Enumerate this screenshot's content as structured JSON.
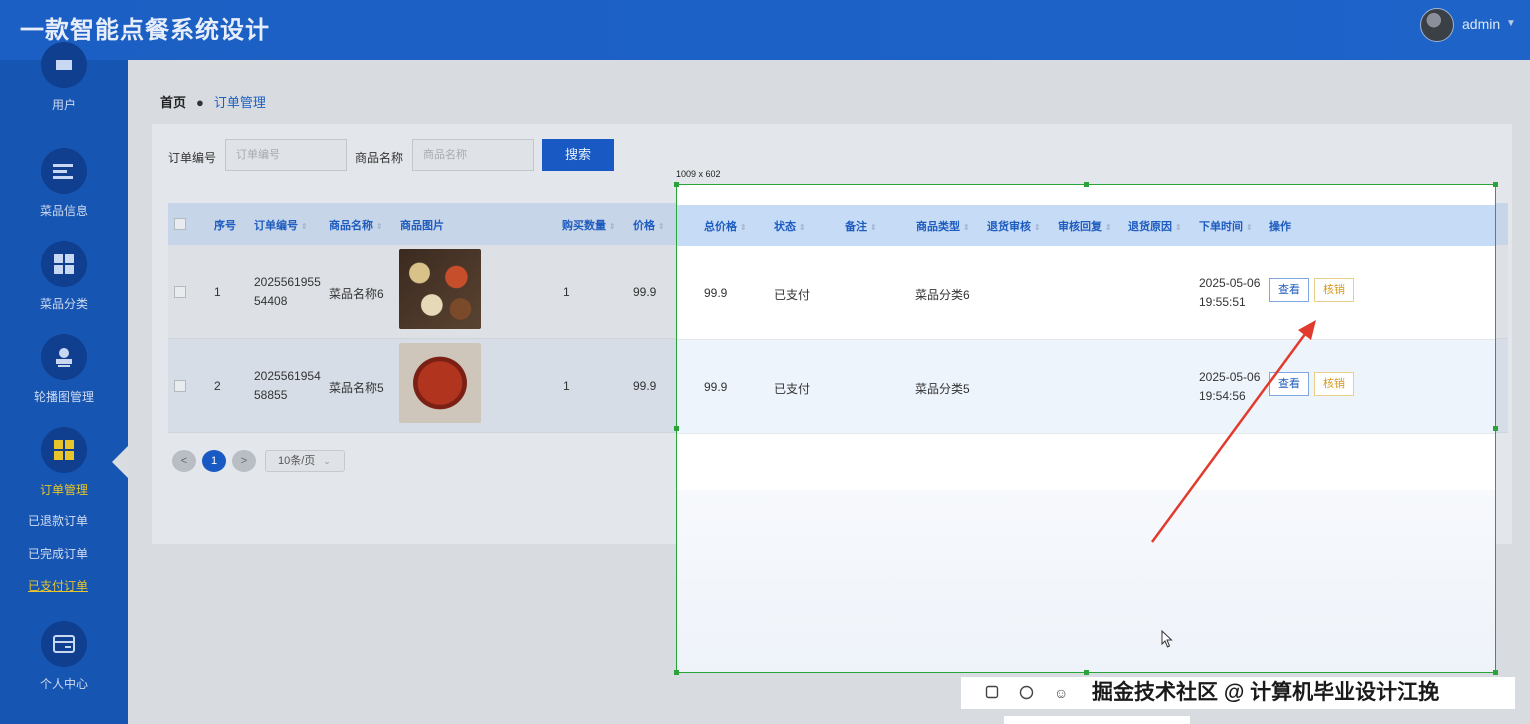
{
  "header": {
    "title": "一款智能点餐系统设计",
    "user": "admin"
  },
  "sidebar": {
    "items": [
      {
        "label": "用户",
        "icon": "user-icon"
      },
      {
        "label": "菜品信息",
        "icon": "list-icon"
      },
      {
        "label": "菜品分类",
        "icon": "grid-icon"
      },
      {
        "label": "轮播图管理",
        "icon": "stamp-icon"
      },
      {
        "label": "订单管理",
        "icon": "grid-icon"
      },
      {
        "label": "个人中心",
        "icon": "card-icon"
      }
    ],
    "subitems": [
      "已退款订单",
      "已完成订单",
      "已支付订单"
    ]
  },
  "breadcrumb": {
    "home": "首页",
    "current": "订单管理"
  },
  "search": {
    "order_no_label": "订单编号",
    "order_no_placeholder": "订单编号",
    "product_label": "商品名称",
    "product_placeholder": "商品名称",
    "button": "搜索"
  },
  "table": {
    "headers": {
      "index": "序号",
      "order_no": "订单编号",
      "product_name": "商品名称",
      "product_image": "商品图片",
      "quantity": "购买数量",
      "price": "价格",
      "total": "总价格",
      "status": "状态",
      "remark": "备注",
      "category": "商品类型",
      "refund_review": "退货审核",
      "review_reply": "审核回复",
      "refund_reason": "退货原因",
      "order_time": "下单时间",
      "actions": "操作"
    },
    "rows": [
      {
        "index": "1",
        "order_no_1": "2025561955",
        "order_no_2": "54408",
        "product_name": "菜品名称6",
        "quantity": "1",
        "price": "99.9",
        "total": "99.9",
        "status": "已支付",
        "category": "菜品分类6",
        "time_date": "2025-05-06",
        "time_clock": "19:55:51"
      },
      {
        "index": "2",
        "order_no_1": "2025561954",
        "order_no_2": "58855",
        "product_name": "菜品名称5",
        "quantity": "1",
        "price": "99.9",
        "total": "99.9",
        "status": "已支付",
        "category": "菜品分类5",
        "time_date": "2025-05-06",
        "time_clock": "19:54:56"
      }
    ],
    "actions": {
      "view": "查看",
      "verify": "核销"
    }
  },
  "pagination": {
    "prev": "<",
    "page": "1",
    "next": ">",
    "page_size": "10条/页"
  },
  "capture": {
    "size_label": "1009 x 602",
    "watermark": "掘金技术社区 @ 计算机毕业设计江挽"
  },
  "colors": {
    "accent": "#1959c4",
    "sidebar": "#1655b2",
    "active": "#e7c52b",
    "selection": "#2aa33a",
    "arrow": "#e23b2e"
  }
}
